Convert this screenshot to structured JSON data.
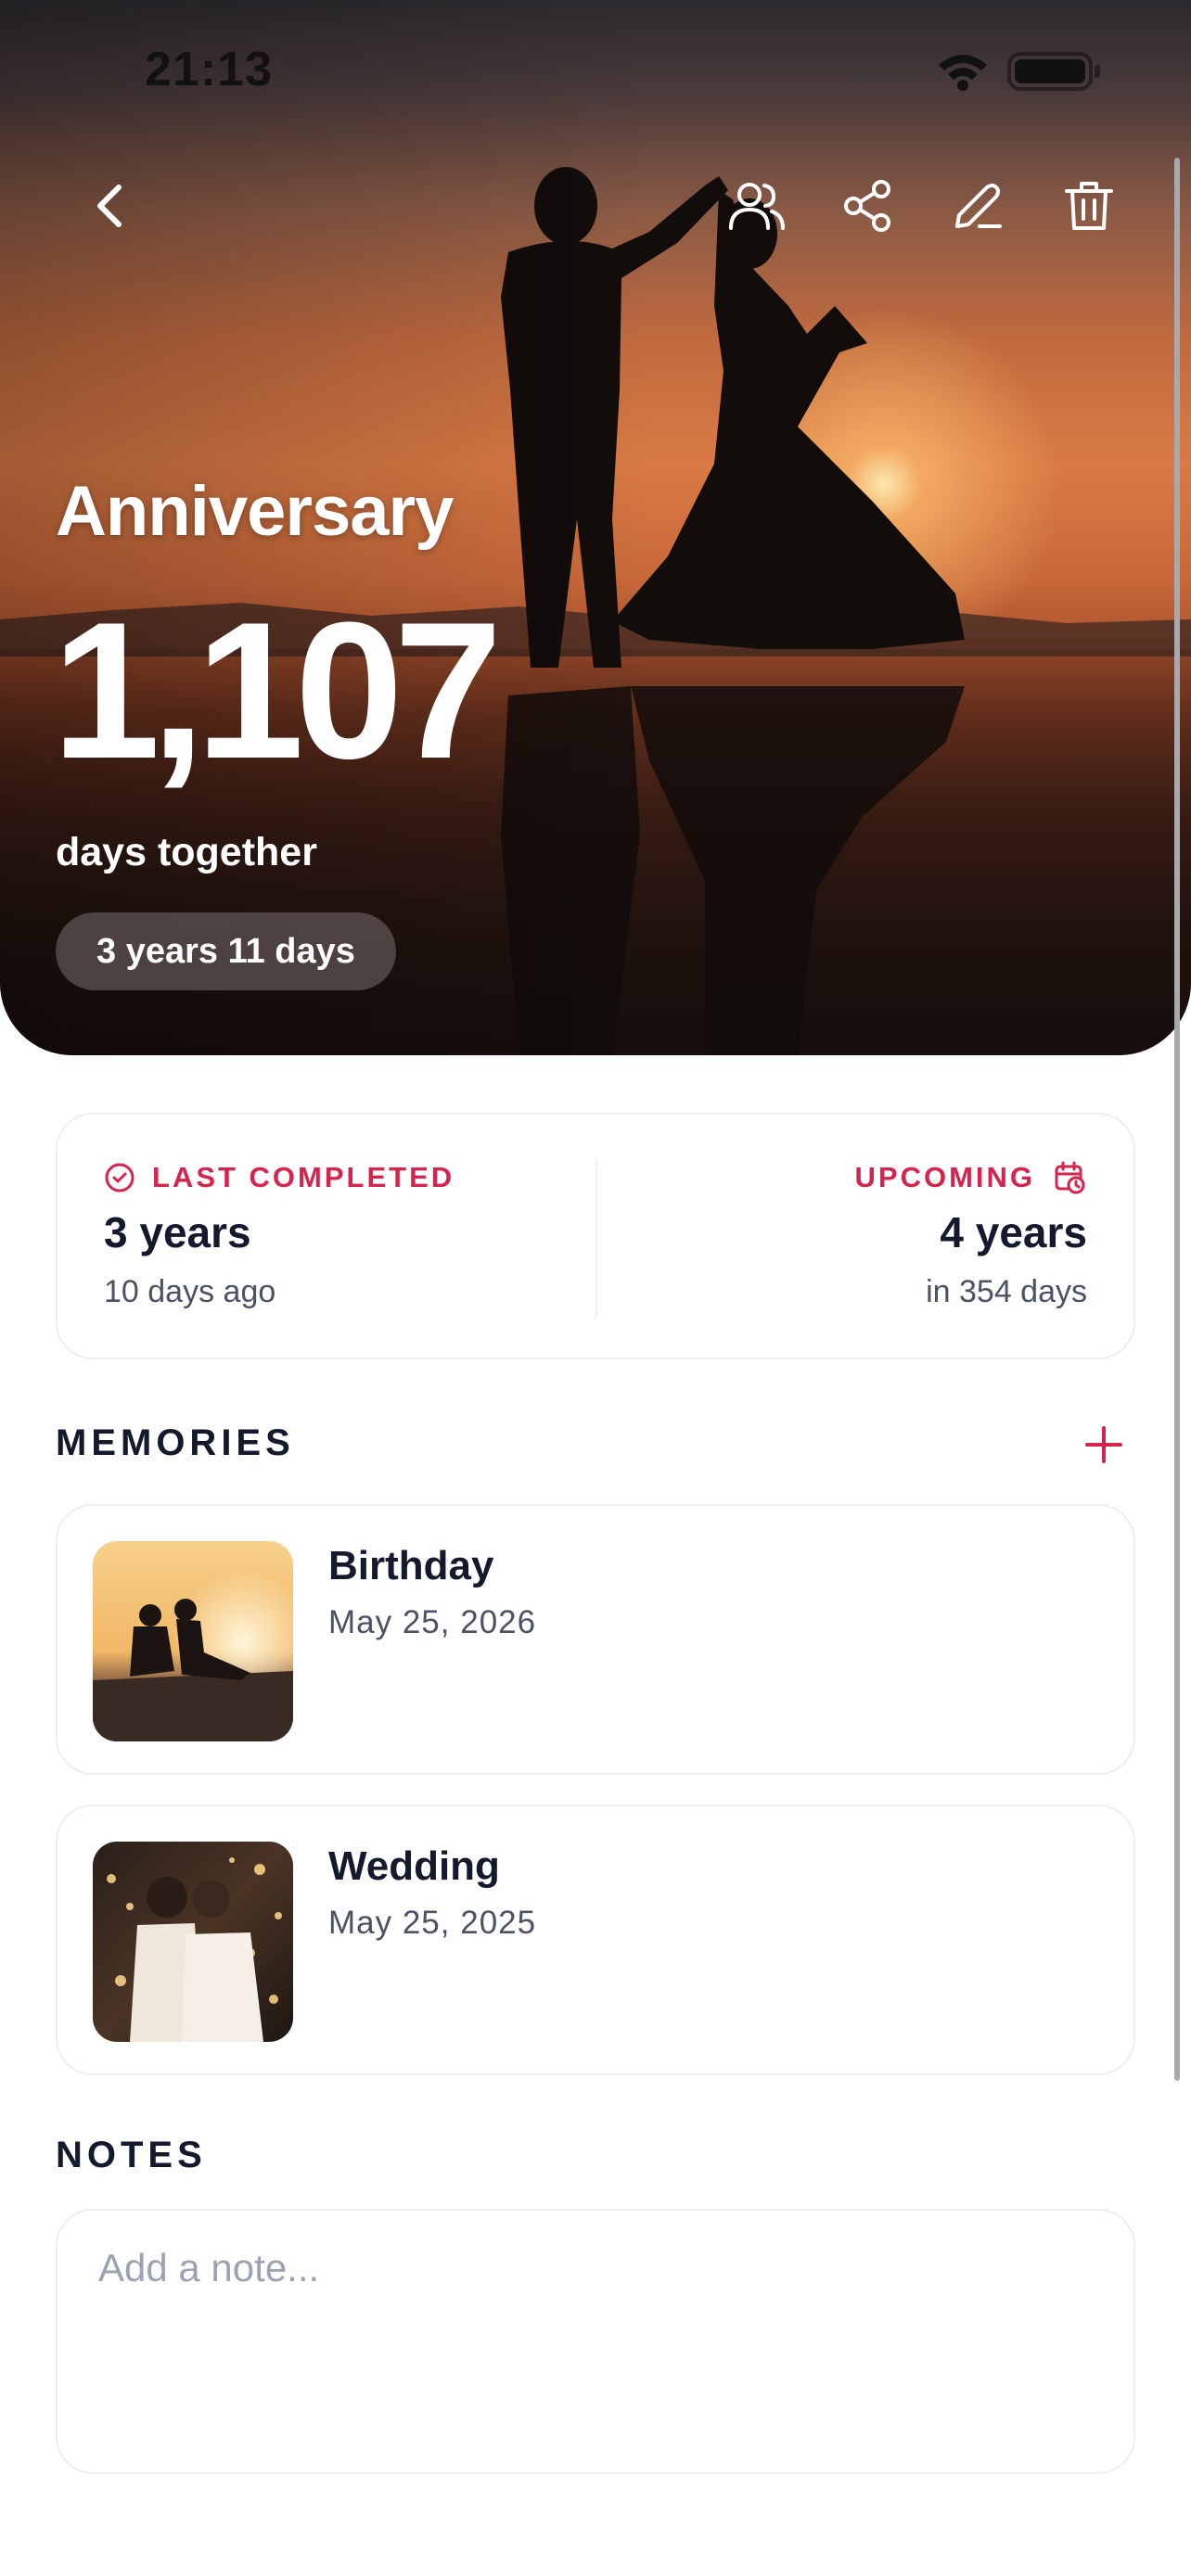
{
  "status_bar": {
    "time": "21:13"
  },
  "hero": {
    "title": "Anniversary",
    "count": "1,107",
    "subtitle": "days together",
    "duration_pill": "3 years 11 days"
  },
  "top_actions": {
    "back": "chevron-left-icon",
    "people": "people-icon",
    "share": "share-icon",
    "edit": "pencil-icon",
    "delete": "trash-icon"
  },
  "stats": {
    "last_completed": {
      "label": "LAST COMPLETED",
      "value": "3 years",
      "detail": "10 days ago"
    },
    "upcoming": {
      "label": "UPCOMING",
      "value": "4 years",
      "detail": "in 354 days"
    }
  },
  "memories": {
    "title": "MEMORIES",
    "items": [
      {
        "title": "Birthday",
        "date": "May 25, 2026"
      },
      {
        "title": "Wedding",
        "date": "May 25, 2025"
      }
    ]
  },
  "notes": {
    "title": "NOTES",
    "placeholder": "Add a note..."
  },
  "colors": {
    "accent": "#d6244e",
    "text": "#141a2e",
    "muted": "#4b5263"
  }
}
